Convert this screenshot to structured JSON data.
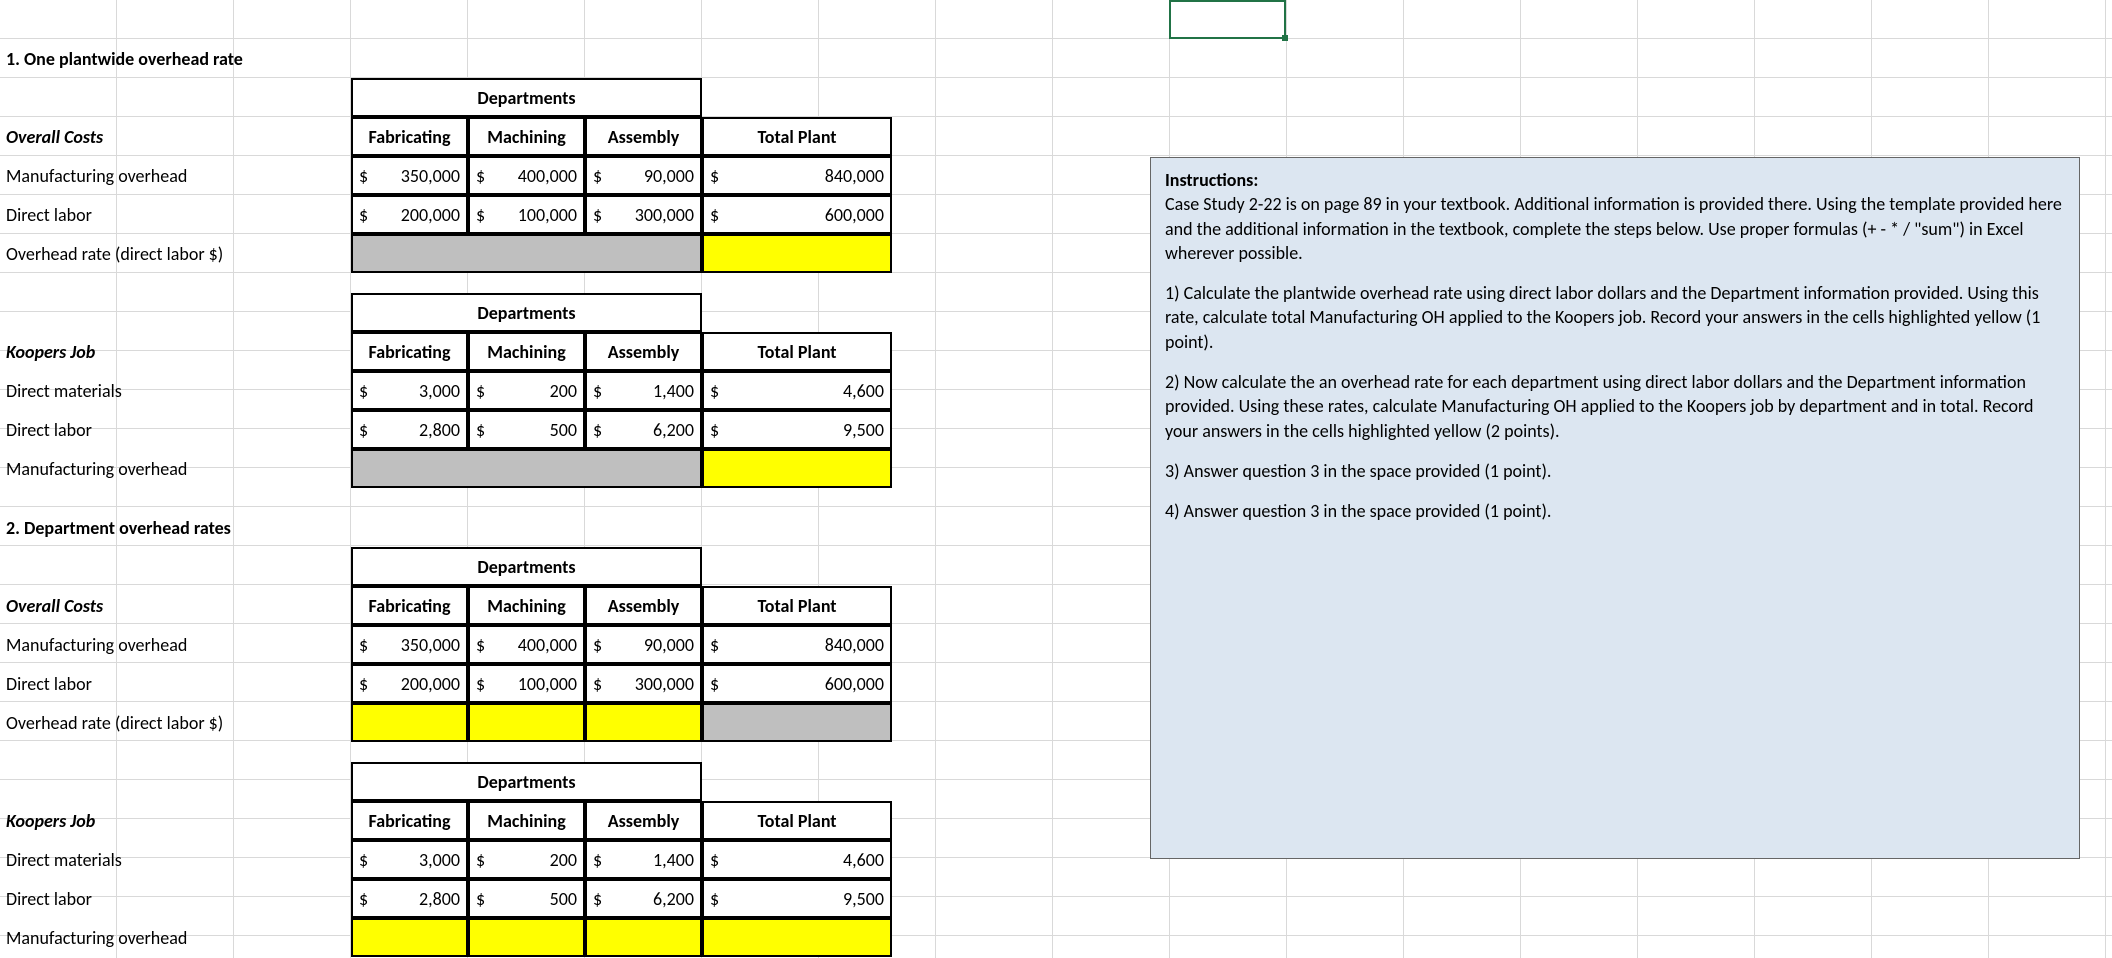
{
  "headings": {
    "section1": "1. One plantwide overhead rate",
    "section2": "2. Department overhead rates",
    "departments": "Departments",
    "overall_costs": "Overall Costs",
    "koopers_job": "Koopers Job",
    "total_plant": "Total Plant"
  },
  "cols": {
    "fabricating": "Fabricating",
    "machining": "Machining",
    "assembly": "Assembly"
  },
  "rows": {
    "mfg_oh": "Manufacturing overhead",
    "direct_labor": "Direct labor",
    "oh_rate": "Overhead rate (direct labor $)",
    "direct_materials": "Direct materials"
  },
  "t1_overall": {
    "mfg_oh": {
      "fab": "350,000",
      "mach": "400,000",
      "asm": "90,000",
      "total": "840,000"
    },
    "direct_labor": {
      "fab": "200,000",
      "mach": "100,000",
      "asm": "300,000",
      "total": "600,000"
    }
  },
  "t1_koopers": {
    "dm": {
      "fab": "3,000",
      "mach": "200",
      "asm": "1,400",
      "total": "4,600"
    },
    "dl": {
      "fab": "2,800",
      "mach": "500",
      "asm": "6,200",
      "total": "9,500"
    }
  },
  "t2_overall": {
    "mfg_oh": {
      "fab": "350,000",
      "mach": "400,000",
      "asm": "90,000",
      "total": "840,000"
    },
    "direct_labor": {
      "fab": "200,000",
      "mach": "100,000",
      "asm": "300,000",
      "total": "600,000"
    }
  },
  "t2_koopers": {
    "dm": {
      "fab": "3,000",
      "mach": "200",
      "asm": "1,400",
      "total": "4,600"
    },
    "dl": {
      "fab": "2,800",
      "mach": "500",
      "asm": "6,200",
      "total": "9,500"
    }
  },
  "instructions": {
    "title": "Instructions:",
    "p0": "Case Study 2-22 is on page 89 in your textbook. Additional information is provided there. Using the template provided here and the additional information in the textbook, complete the steps below. Use proper formulas (+ - * / \"sum\") in Excel wherever possible.",
    "p1": "1) Calculate the plantwide overhead rate using direct labor dollars and the Department information provided. Using this rate, calculate total Manufacturing OH applied to the Koopers job. Record your answers in the cells highlighted yellow (1 point).",
    "p2": "2) Now calculate the an overhead rate for each department using direct labor dollars and the Department information provided. Using these rates, calculate Manufacturing OH applied to the Koopers job by department and in total. Record your answers in the cells highlighted yellow (2 points).",
    "p3": "3) Answer question 3 in the space provided (1 point).",
    "p4": "4) Answer question 3 in the space provided (1 point)."
  }
}
